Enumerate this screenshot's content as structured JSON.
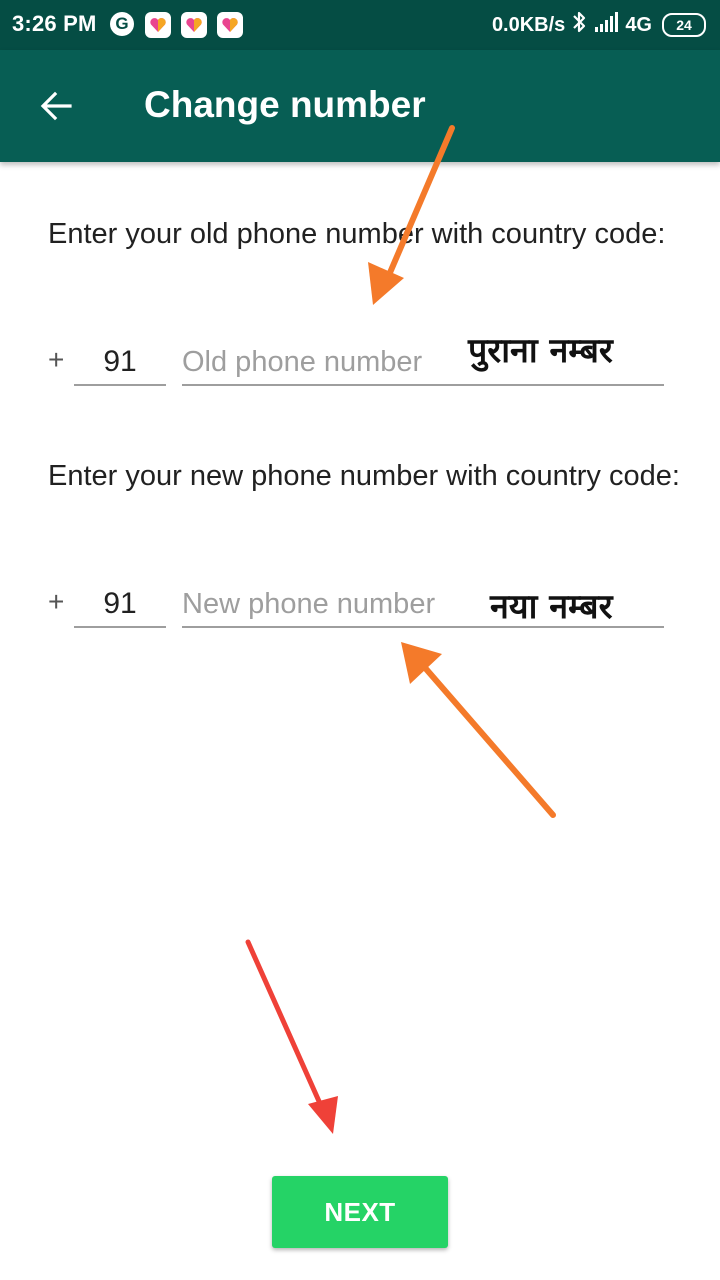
{
  "status_bar": {
    "time": "3:26 PM",
    "g_letter": "G",
    "net_speed": "0.0KB/s",
    "network_type": "4G",
    "battery": "24",
    "icons": [
      "google-icon",
      "likee-icon",
      "likee-icon",
      "likee-icon",
      "bluetooth-icon",
      "signal-icon",
      "battery-icon"
    ]
  },
  "app_bar": {
    "title": "Change number",
    "back_icon": "arrow-back-icon"
  },
  "old_number": {
    "instruction": "Enter your old phone number with country code:",
    "plus": "+",
    "country_code": "91",
    "placeholder": "Old phone number",
    "annotation": "पुराना नम्बर"
  },
  "new_number": {
    "instruction": "Enter your new phone number with country code:",
    "plus": "+",
    "country_code": "91",
    "placeholder": "New phone number",
    "annotation": "नया नम्बर"
  },
  "next_button": {
    "label": "NEXT"
  },
  "colors": {
    "status_bar": "#054d44",
    "app_bar": "#075e54",
    "button": "#25d366",
    "arrow_orange": "#f47a2a",
    "arrow_red": "#ef4138"
  }
}
